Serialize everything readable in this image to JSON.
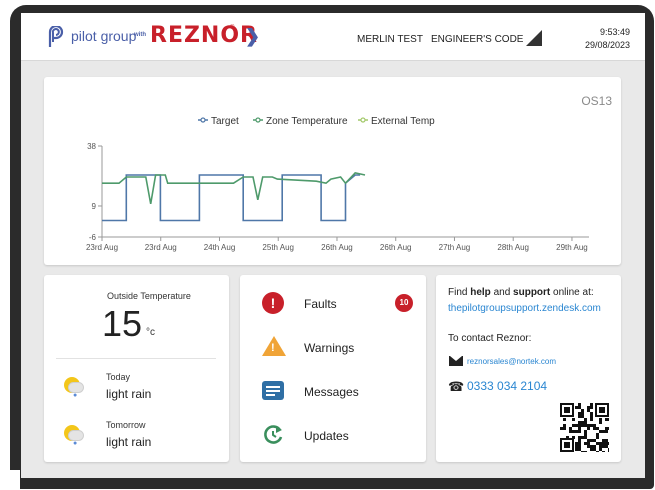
{
  "header": {
    "brand": "pilot group",
    "with": "with",
    "partner": "REZNOR",
    "registered": "®",
    "site_name": "MERLIN TEST",
    "access_level": "ENGINEER'S CODE",
    "time": "9:53:49",
    "date": "29/08/2023",
    "icons": [
      "pilot-logo-icon",
      "chevron-right-icon",
      "signal-icon"
    ]
  },
  "chart": {
    "corner_label": "OS13"
  },
  "chart_data": {
    "type": "line",
    "title": "",
    "xlabel": "",
    "ylabel": "",
    "x_ticks": [
      "23rd Aug",
      "23rd Aug",
      "24th Aug",
      "25th Aug",
      "26th Aug",
      "26th Aug",
      "27th Aug",
      "28th Aug",
      "29th Aug"
    ],
    "y_ticks": [
      38,
      9,
      -6
    ],
    "ylim": [
      -6,
      38
    ],
    "grid": false,
    "legend_position": "top",
    "series": [
      {
        "name": "Target",
        "color": "#4f77a8",
        "points": [
          [
            0,
            2
          ],
          [
            0.05,
            2
          ],
          [
            0.05,
            24
          ],
          [
            0.12,
            24
          ],
          [
            0.12,
            2
          ],
          [
            0.2,
            2
          ],
          [
            0.2,
            24
          ],
          [
            0.29,
            24
          ],
          [
            0.29,
            2
          ],
          [
            0.37,
            2
          ],
          [
            0.37,
            24
          ],
          [
            0.45,
            24
          ],
          [
            0.45,
            2
          ],
          [
            0.5,
            2
          ],
          [
            0.5,
            20
          ],
          [
            0.52,
            24
          ],
          [
            0.53,
            24
          ]
        ]
      },
      {
        "name": "Zone Temperature",
        "color": "#4e9a6b",
        "points": [
          [
            0,
            20
          ],
          [
            0.035,
            20
          ],
          [
            0.05,
            23
          ],
          [
            0.09,
            23
          ],
          [
            0.1,
            10
          ],
          [
            0.11,
            24
          ],
          [
            0.13,
            24
          ],
          [
            0.135,
            20
          ],
          [
            0.27,
            20
          ],
          [
            0.29,
            23
          ],
          [
            0.31,
            23
          ],
          [
            0.32,
            12
          ],
          [
            0.33,
            23
          ],
          [
            0.35,
            23
          ],
          [
            0.36,
            22
          ],
          [
            0.44,
            21
          ],
          [
            0.46,
            20
          ],
          [
            0.47,
            22
          ],
          [
            0.49,
            23
          ],
          [
            0.5,
            20
          ],
          [
            0.52,
            25
          ],
          [
            0.54,
            24
          ]
        ]
      },
      {
        "name": "External Temp",
        "color": "#a3c96a",
        "points": []
      }
    ]
  },
  "weather": {
    "outside_label": "Outside Temperature",
    "outside_value": "15",
    "outside_unit": "°c",
    "today_label": "Today",
    "today_desc": "light rain",
    "tomorrow_label": "Tomorrow",
    "tomorrow_desc": "light rain",
    "icon": "light-rain-icon"
  },
  "alerts": {
    "faults_label": "Faults",
    "faults_count": "10",
    "warnings_label": "Warnings",
    "messages_label": "Messages",
    "updates_label": "Updates",
    "icons": [
      "fault-icon",
      "warning-icon",
      "message-icon",
      "update-icon"
    ],
    "colors": {
      "fault": "#c8202a",
      "warning": "#f0a437",
      "message": "#2f6fa5",
      "update": "#3a8f5d"
    }
  },
  "support": {
    "find_prefix": "Find ",
    "find_help": "help",
    "find_and": " and ",
    "find_support": "support",
    "find_suffix": " online at:",
    "url": "thepilotgroupsupport.zendesk.com",
    "contact_label": "To contact Reznor:",
    "email": "reznorsales@nortek.com",
    "phone": "0333 034 2104",
    "icons": [
      "mail-icon",
      "phone-icon",
      "qr-code-icon"
    ]
  }
}
